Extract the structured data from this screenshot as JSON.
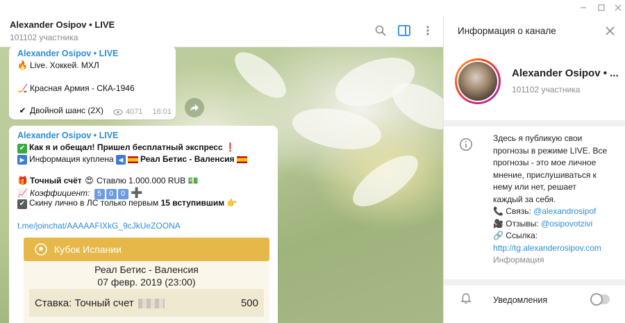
{
  "header": {
    "title": "Alexander Osipov • LIVE",
    "subscribers": "101102 участника"
  },
  "messages": [
    {
      "author": "Alexander Osipov • LIVE",
      "lines": [
        {
          "icon": "fire-icon",
          "glyph": "🔥",
          "text": "Live. Хоккей. МХЛ"
        },
        {
          "icon": "hockey-icon",
          "glyph": "🏒",
          "text": "Красная Армия - СКА-1946"
        },
        {
          "icon": "check-icon",
          "glyph": "✔",
          "text": "Двойной шанс (2X)"
        }
      ],
      "views": "4071",
      "time": "16:01"
    },
    {
      "author": "Alexander Osipov • LIVE",
      "line1": "Как я и обещал! Пришел бесплатный экспресс",
      "line2_a": "Информация куплена",
      "line2_b": "Реал Бетис - Валенсия",
      "line3_a": "Точный счёт",
      "line3_b": "Ставлю 1.000.000 RUB",
      "line4_a": "Коэффициент:",
      "line4_digits": [
        "5",
        "0",
        "0"
      ],
      "line5_a": "Скину лично в ЛС только первым",
      "line5_b": "15 вступившим",
      "link": "t.me/joinchat/AAAAAFIXkG_9cJkUeZOONA",
      "card": {
        "league": "Кубок Испании",
        "match": "Реал Бетис - Валенсия",
        "date": "07 февр. 2019 (23:00)",
        "bet_label": "Ставка: Точный счет",
        "bet_value": "500"
      }
    }
  ],
  "panel": {
    "title": "Информация о канале",
    "channel_name": "Alexander Osipov • ...",
    "subscribers": "101102 участника",
    "description_lines": [
      "Здесь я публикую свои",
      "прогнозы в режиме LIVE. Все",
      "прогнозы - это мое личное",
      "мнение, прислушиваться к",
      "нему или нет, решает",
      "каждый за себя."
    ],
    "contact_label": "Связь:",
    "contact_value": "@alexandrosipof",
    "reviews_label": "Отзывы:",
    "reviews_value": "@osipovotzivi",
    "link_label": "Ссылка:",
    "link_value": "http://tg.alexanderosipov.com",
    "info_caption": "Информация",
    "notifications_label": "Уведомления",
    "notifications_enabled": false
  },
  "colors": {
    "accent": "#2b8ed6",
    "card_header": "#e6b84a",
    "card_body": "#fbf6ea"
  }
}
